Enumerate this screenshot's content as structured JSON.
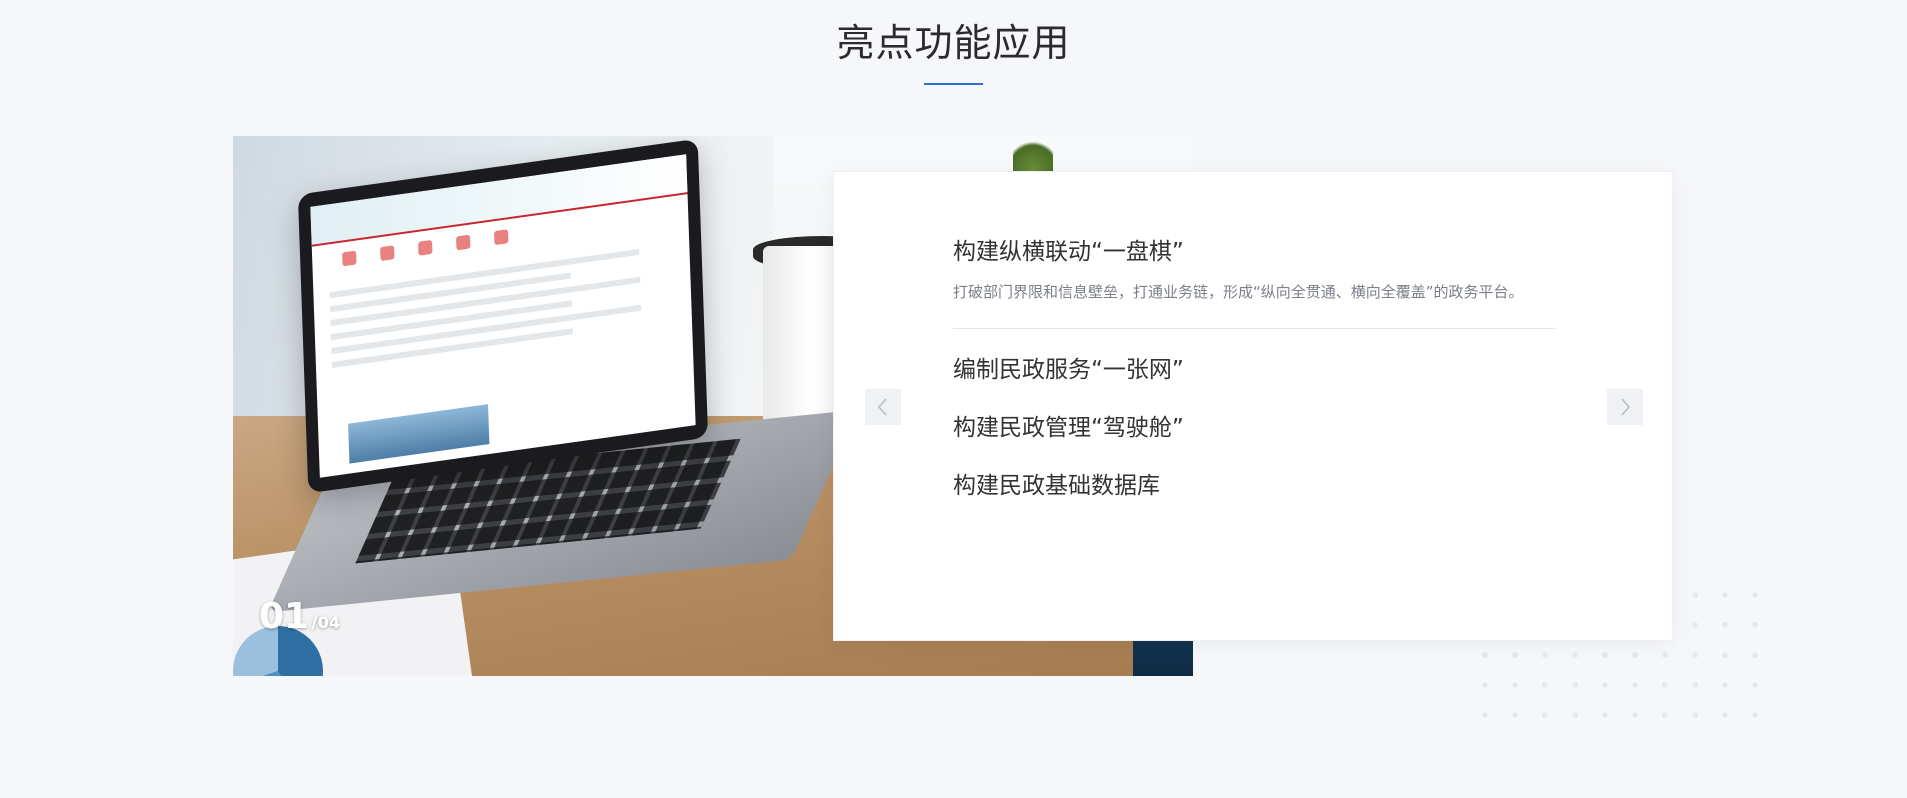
{
  "section": {
    "title": "亮点功能应用"
  },
  "slider": {
    "current": "01",
    "separator": "/",
    "total": "04",
    "prev_icon": "chevron-left-icon",
    "next_icon": "chevron-right-icon"
  },
  "features": {
    "active": {
      "title": "构建纵横联动“一盘棋”",
      "description": "打破部门界限和信息壁垒，打通业务链，形成“纵向全贯通、横向全覆盖”的政务平台。"
    },
    "items": [
      {
        "title": "编制民政服务“一张网”"
      },
      {
        "title": "构建民政管理“驾驶舱”"
      },
      {
        "title": "构建民政基础数据库"
      }
    ]
  },
  "colors": {
    "accent": "#2e6fd6",
    "background": "#f6f7fb",
    "title": "#2b2b2b",
    "description": "#7b7f88"
  }
}
